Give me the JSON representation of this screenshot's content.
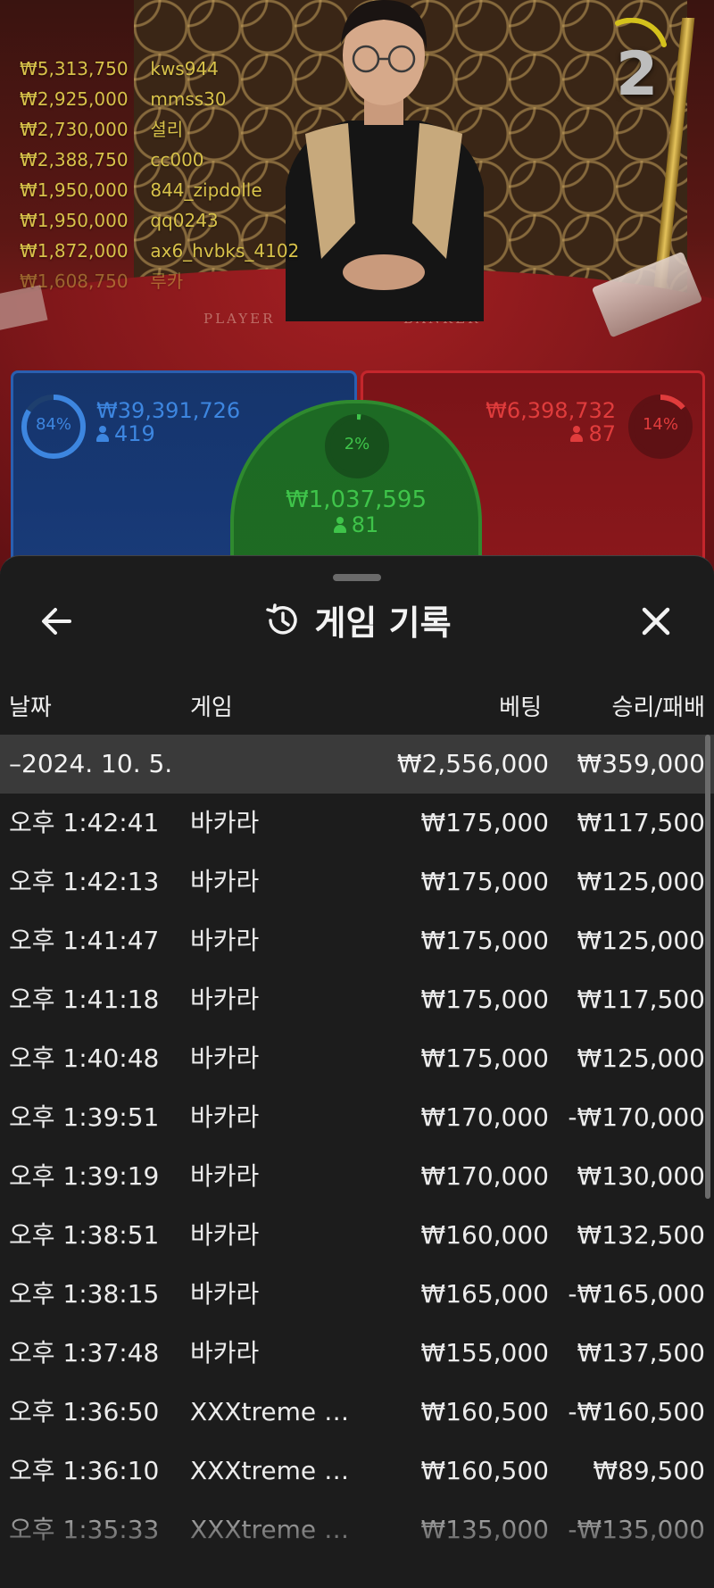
{
  "video": {
    "round_number": "2",
    "table_labels": {
      "player": "PLAYER",
      "banker": "BANKER"
    },
    "winners": [
      {
        "amount": "₩5,313,750",
        "user": "kws944"
      },
      {
        "amount": "₩2,925,000",
        "user": "mmss30"
      },
      {
        "amount": "₩2,730,000",
        "user": "셜리"
      },
      {
        "amount": "₩2,388,750",
        "user": "cc000"
      },
      {
        "amount": "₩1,950,000",
        "user": "844_zipdolle"
      },
      {
        "amount": "₩1,950,000",
        "user": "qq0243"
      },
      {
        "amount": "₩1,872,000",
        "user": "ax6_hvbks_4102"
      },
      {
        "amount": "₩1,608,750",
        "user": "루카"
      }
    ]
  },
  "bets": {
    "player": {
      "percent": "84%",
      "percent_value": 0.84,
      "amount": "₩39,391,726",
      "count": "419",
      "color": "#3d86e0"
    },
    "banker": {
      "percent": "14%",
      "percent_value": 0.14,
      "amount": "₩6,398,732",
      "count": "87",
      "color": "#e03c3c"
    },
    "tie": {
      "percent": "2%",
      "percent_value": 0.02,
      "amount": "₩1,037,595",
      "count": "81",
      "color": "#3fc44a"
    }
  },
  "history": {
    "title": "게임 기록",
    "columns": {
      "date": "날짜",
      "game": "게임",
      "bet": "베팅",
      "result": "승리/패배"
    },
    "date_group": {
      "date": "–2024. 10. 5.",
      "bet": "₩2,556,000",
      "result": "₩359,000"
    },
    "rows": [
      {
        "time": "오후 1:42:41",
        "game": "바카라",
        "bet": "₩175,000",
        "result": "₩117,500"
      },
      {
        "time": "오후 1:42:13",
        "game": "바카라",
        "bet": "₩175,000",
        "result": "₩125,000"
      },
      {
        "time": "오후 1:41:47",
        "game": "바카라",
        "bet": "₩175,000",
        "result": "₩125,000"
      },
      {
        "time": "오후 1:41:18",
        "game": "바카라",
        "bet": "₩175,000",
        "result": "₩117,500"
      },
      {
        "time": "오후 1:40:48",
        "game": "바카라",
        "bet": "₩175,000",
        "result": "₩125,000"
      },
      {
        "time": "오후 1:39:51",
        "game": "바카라",
        "bet": "₩170,000",
        "result": "-₩170,000"
      },
      {
        "time": "오후 1:39:19",
        "game": "바카라",
        "bet": "₩170,000",
        "result": "₩130,000"
      },
      {
        "time": "오후 1:38:51",
        "game": "바카라",
        "bet": "₩160,000",
        "result": "₩132,500"
      },
      {
        "time": "오후 1:38:15",
        "game": "바카라",
        "bet": "₩165,000",
        "result": "-₩165,000"
      },
      {
        "time": "오후 1:37:48",
        "game": "바카라",
        "bet": "₩155,000",
        "result": "₩137,500"
      },
      {
        "time": "오후 1:36:50",
        "game": "XXXtreme 라...",
        "bet": "₩160,500",
        "result": "-₩160,500"
      },
      {
        "time": "오후 1:36:10",
        "game": "XXXtreme 라...",
        "bet": "₩160,500",
        "result": "₩89,500"
      },
      {
        "time": "오후 1:35:33",
        "game": "XXXtreme 라...",
        "bet": "₩135,000",
        "result": "-₩135,000"
      }
    ]
  },
  "icons": {
    "back": "arrow-left-icon",
    "history": "history-clock-icon",
    "close": "close-icon",
    "person": "person-icon"
  }
}
